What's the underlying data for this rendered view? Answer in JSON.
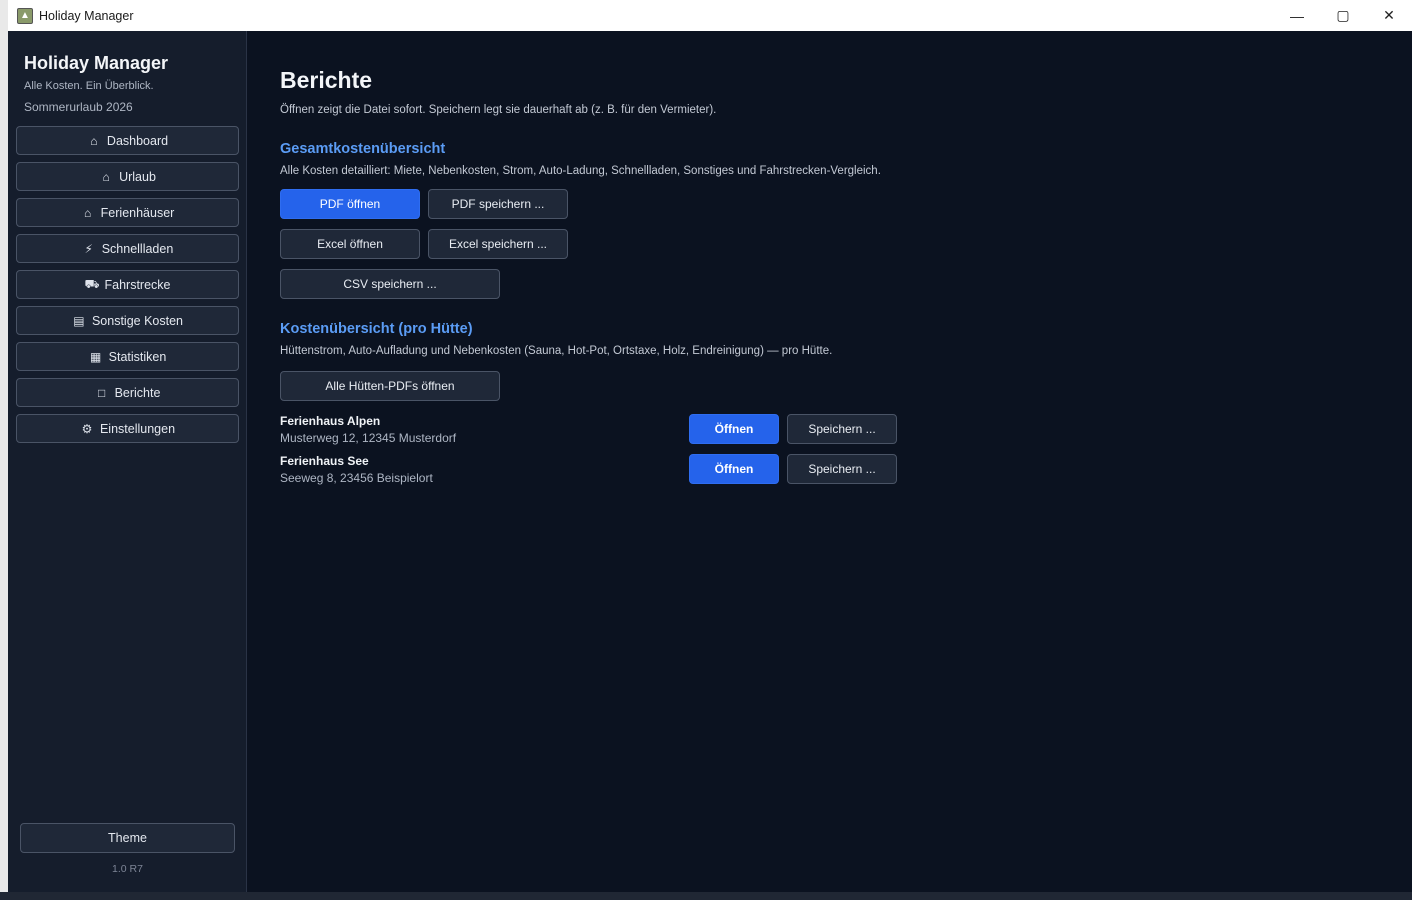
{
  "window": {
    "title": "Holiday Manager",
    "minimize_glyph": "—",
    "maximize_glyph": "▢",
    "close_glyph": "✕"
  },
  "sidebar": {
    "app_title": "Holiday Manager",
    "tagline": "Alle Kosten. Ein Überblick.",
    "trip_name": "Sommerurlaub 2026",
    "items": [
      {
        "label": "Dashboard",
        "icon": "dashboard-icon"
      },
      {
        "label": "Urlaub",
        "icon": "home-icon"
      },
      {
        "label": "Ferienhäuser",
        "icon": "houses-icon"
      },
      {
        "label": "Schnellladen",
        "icon": "lightning-icon"
      },
      {
        "label": "Fahrstrecke",
        "icon": "car-icon"
      },
      {
        "label": "Sonstige Kosten",
        "icon": "cart-icon"
      },
      {
        "label": "Statistiken",
        "icon": "chart-icon"
      },
      {
        "label": "Berichte",
        "icon": "document-icon"
      },
      {
        "label": "Einstellungen",
        "icon": "gear-icon"
      }
    ],
    "theme_label": "Theme",
    "version": "1.0 R7"
  },
  "main": {
    "title": "Berichte",
    "description": "Öffnen zeigt die Datei sofort. Speichern legt sie dauerhaft ab (z. B. für den Vermieter).",
    "overview": {
      "title": "Gesamtkostenübersicht",
      "description": "Alle Kosten detailliert: Miete, Nebenkosten, Strom, Auto-Ladung, Schnellladen, Sonstiges und Fahrstrecken-Vergleich.",
      "pdf_open": "PDF öffnen",
      "pdf_save": "PDF speichern ...",
      "excel_open": "Excel öffnen",
      "excel_save": "Excel speichern ...",
      "csv_save": "CSV speichern ..."
    },
    "per_cabin": {
      "title": "Kostenübersicht (pro Hütte)",
      "description": "Hüttenstrom, Auto-Aufladung und Nebenkosten (Sauna, Hot-Pot, Ortstaxe, Holz, Endreinigung) — pro Hütte.",
      "all_pdfs": "Alle Hütten-PDFs öffnen",
      "houses": [
        {
          "name": "Ferienhaus Alpen",
          "address": "Musterweg 12, 12345 Musterdorf",
          "open": "Öffnen",
          "save": "Speichern ..."
        },
        {
          "name": "Ferienhaus See",
          "address": "Seeweg 8, 23456 Beispielort",
          "open": "Öffnen",
          "save": "Speichern ..."
        }
      ]
    }
  },
  "colors": {
    "accent": "#2563eb",
    "section_title": "#5b9cf5",
    "background": "#0b1220",
    "sidebar": "#151d2c"
  }
}
